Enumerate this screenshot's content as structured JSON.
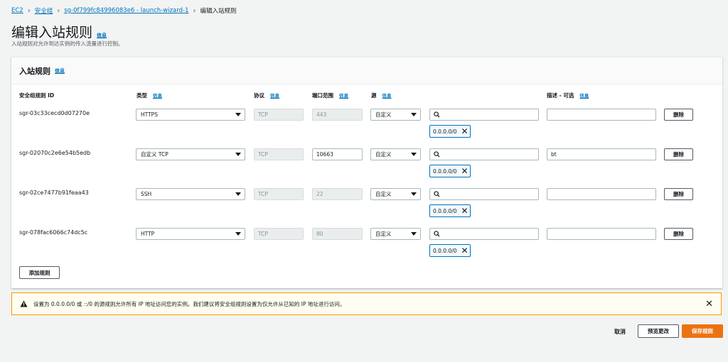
{
  "breadcrumb": {
    "ec2": "EC2",
    "sg": "安全组",
    "sg_id": "sg-0f799fc84996083e6 - launch-wizard-1",
    "current": "编辑入站规则"
  },
  "page": {
    "title": "编辑入站规则",
    "info": "信息",
    "subtitle": "入站规则对允许到达实例的传入流量进行控制。"
  },
  "panel": {
    "title": "入站规则",
    "info": "信息"
  },
  "columns": {
    "id": "安全组规则 ID",
    "type": "类型",
    "protocol": "协议",
    "port": "端口范围",
    "source": "源",
    "desc": "描述 - 可选",
    "info": "信息"
  },
  "rules": [
    {
      "id": "sgr-03c33cecd0d07270e",
      "type": "HTTPS",
      "protocol": "TCP",
      "port": "443",
      "source": "自定义",
      "cidr": "0.0.0.0/0",
      "desc": "",
      "delete": "删除"
    },
    {
      "id": "sgr-02070c2e6e54b5edb",
      "type": "自定义 TCP",
      "protocol": "TCP",
      "port": "10663",
      "source": "自定义",
      "cidr": "0.0.0.0/0",
      "desc": "bt",
      "delete": "删除"
    },
    {
      "id": "sgr-02ce7477b91feaa43",
      "type": "SSH",
      "protocol": "TCP",
      "port": "22",
      "source": "自定义",
      "cidr": "0.0.0.0/0",
      "desc": "",
      "delete": "删除"
    },
    {
      "id": "sgr-078fac6066c74dc5c",
      "type": "HTTP",
      "protocol": "TCP",
      "port": "80",
      "source": "自定义",
      "cidr": "0.0.0.0/0",
      "desc": "",
      "delete": "删除"
    }
  ],
  "add_rule": "添加规则",
  "warning": "设置为 0.0.0.0/0 或 ::/0 的源规则允许所有 IP 地址访问您的实例。我们建议将安全组规则设置为仅允许从已知的 IP 地址进行访问。",
  "footer": {
    "cancel": "取消",
    "preview": "预览更改",
    "save": "保存规则"
  },
  "colors": {
    "accent": "#0073bb",
    "primary": "#ec7211",
    "warning": "#ff9900"
  }
}
